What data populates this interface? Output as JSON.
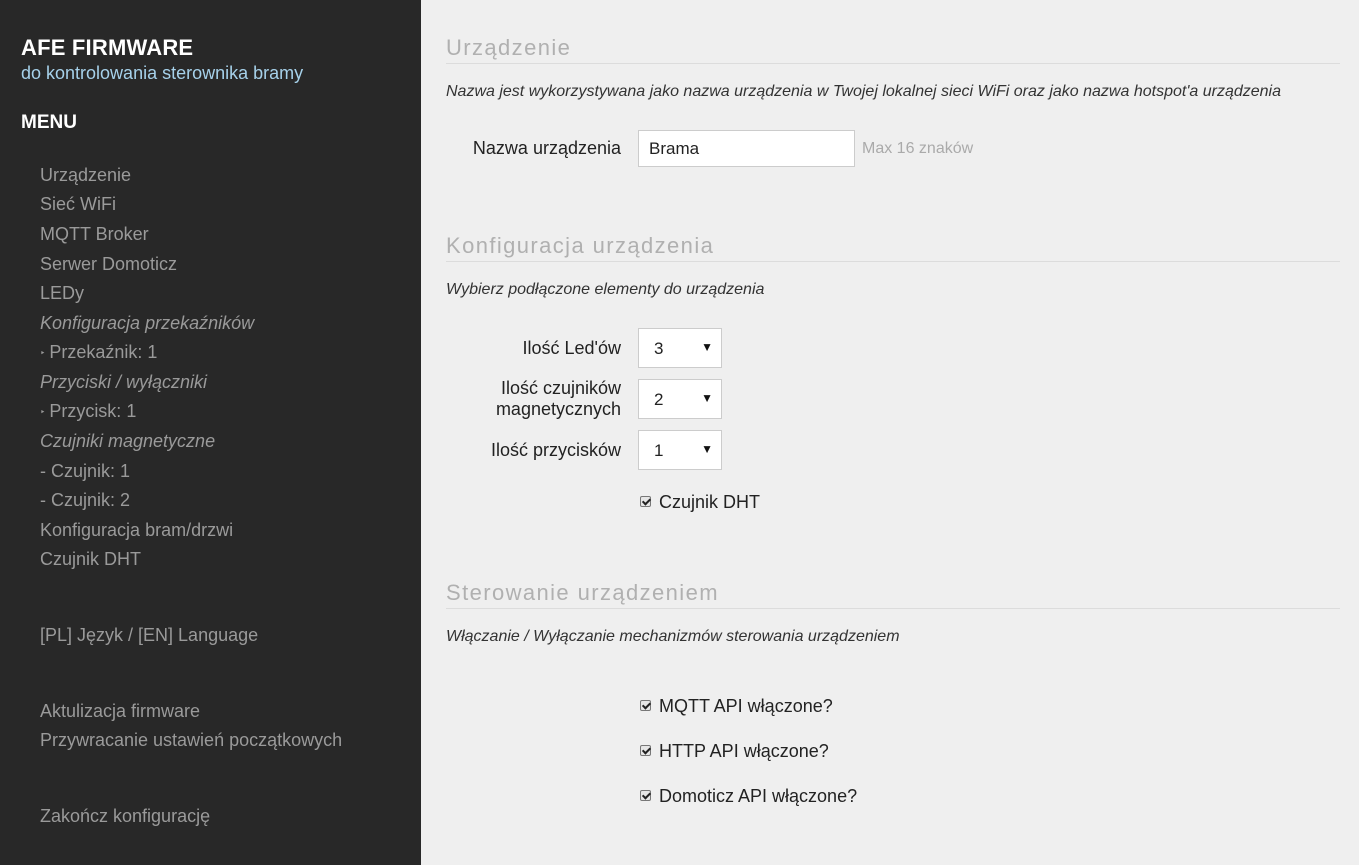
{
  "brand": {
    "title": "AFE FIRMWARE",
    "subtitle": "do kontrolowania sterownika bramy"
  },
  "menu": {
    "heading": "MENU",
    "items": {
      "device": "Urządzenie",
      "wifi": "Sieć WiFi",
      "mqtt": "MQTT Broker",
      "domoticz": "Serwer Domoticz",
      "leds": "LEDy",
      "relays_group": "Konfiguracja przekaźników",
      "relay1": "Przekaźnik: 1",
      "switches_group": "Przyciski / wyłączniki",
      "switch1": "Przycisk: 1",
      "contactrons_group": "Czujniki magnetyczne",
      "contactron1": "- Czujnik: 1",
      "contactron2": "- Czujnik: 2",
      "gates": "Konfiguracja bram/drzwi",
      "dht": "Czujnik DHT",
      "language": "[PL] Język / [EN] Language",
      "firmware_update": "Aktulizacja firmware",
      "reset": "Przywracanie ustawień początkowych",
      "finish": "Zakończ konfigurację"
    },
    "submenu_marker": "‣"
  },
  "device_section": {
    "title": "Urządzenie",
    "description": "Nazwa jest wykorzystywana jako nazwa urządzenia w Twojej lokalnej sieci WiFi oraz jako nazwa hotspot'a urządzenia",
    "name_label": "Nazwa urządzenia",
    "name_value": "Brama",
    "name_hint": "Max 16 znaków"
  },
  "config_section": {
    "title": "Konfiguracja urządzenia",
    "description": "Wybierz podłączone elementy do urządzenia",
    "leds_label": "Ilość Led'ów",
    "leds_value": "3",
    "contactrons_label_line1": "Ilość czujników",
    "contactrons_label_line2": "magnetycznych",
    "contactrons_value": "2",
    "switches_label": "Ilość przycisków",
    "switches_value": "1",
    "dht_label": "Czujnik DHT",
    "dht_checked": true,
    "select_arrow": "▼"
  },
  "control_section": {
    "title": "Sterowanie urządzeniem",
    "description": "Włączanie / Wyłączanie mechanizmów sterowania urządzeniem",
    "mqtt_api_label": "MQTT API włączone?",
    "http_api_label": "HTTP API włączone?",
    "domoticz_api_label": "Domoticz API włączone?",
    "mqtt_api_checked": true,
    "http_api_checked": true,
    "domoticz_api_checked": true
  },
  "colors": {
    "sidebar_bg": "#282828",
    "sidebar_text": "#9a9a9a",
    "subtitle_accent": "#a6d1ea",
    "main_bg": "#efefef"
  }
}
